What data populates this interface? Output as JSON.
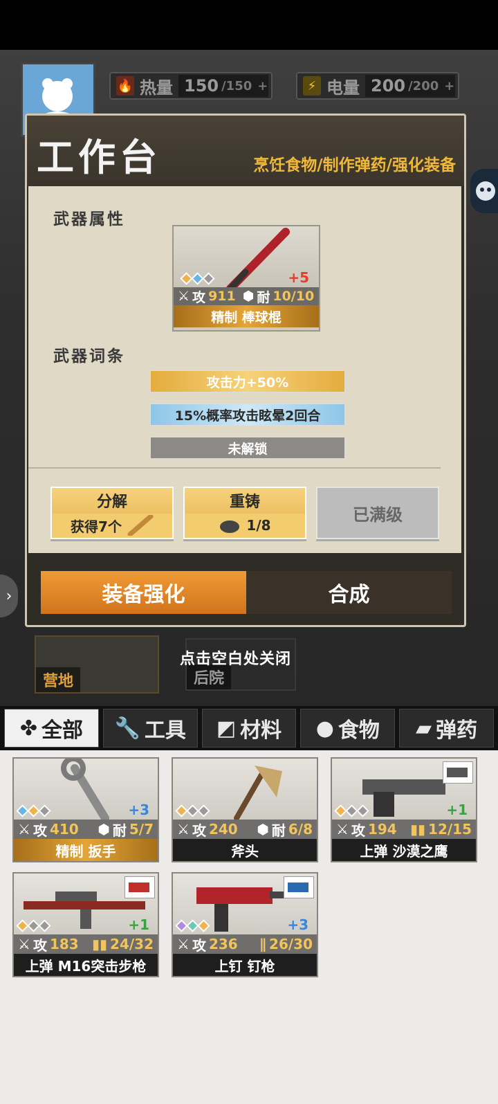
{
  "hud": {
    "heat": {
      "label": "热量",
      "value": "150",
      "max": "/150",
      "plus": "+"
    },
    "power": {
      "label": "电量",
      "value": "200",
      "max": "/200",
      "plus": "+"
    }
  },
  "bg_nav": {
    "camp": "营地",
    "backyard": "后院"
  },
  "hint": "点击空白处关闭",
  "modal": {
    "title": "工作台",
    "subtitle": "烹饪食物/制作弹药/强化装备",
    "attr_label": "武器属性",
    "affix_label": "武器词条",
    "weapon": {
      "plus": "+5",
      "atk_label": "攻",
      "atk": "911",
      "dur_label": "耐",
      "dur": "10/10",
      "name": "精制 棒球棍"
    },
    "affixes": [
      "攻击力+50%",
      "15%概率攻击眩晕2回合",
      "未解锁"
    ],
    "buttons": {
      "decompose": {
        "label": "分解",
        "sub": "获得7个"
      },
      "recast": {
        "label": "重铸",
        "sub": "1/8"
      },
      "maxed": {
        "label": "已满级"
      }
    },
    "tabs": {
      "enhance": "装备强化",
      "craft": "合成"
    }
  },
  "categories": [
    "全部",
    "工具",
    "材料",
    "食物",
    "弹药"
  ],
  "inventory": [
    {
      "name": "精制 扳手",
      "atk": "410",
      "stat2_label": "耐",
      "stat2": "5/7",
      "plus": "+3",
      "plus_color": "blue",
      "name_style": "gold"
    },
    {
      "name": "斧头",
      "atk": "240",
      "stat2_label": "耐",
      "stat2": "6/8",
      "plus": "",
      "name_style": "dark"
    },
    {
      "name": "上弹 沙漠之鹰",
      "atk": "194",
      "stat2_label": "",
      "stat2": "12/15",
      "plus": "+1",
      "plus_color": "green",
      "name_style": "dark"
    },
    {
      "name": "上弹 M16突击步枪",
      "atk": "183",
      "stat2_label": "",
      "stat2": "24/32",
      "plus": "+1",
      "plus_color": "green",
      "name_style": "dark"
    },
    {
      "name": "上钉 钉枪",
      "atk": "236",
      "stat2_label": "",
      "stat2": "26/30",
      "plus": "+3",
      "plus_color": "blue",
      "name_style": "dark"
    }
  ],
  "inv_atk_label": "攻",
  "colors": {
    "accent_gold": "#e6b04e",
    "tab_active": "#e08a2a",
    "title_orange": "#f0b83b"
  }
}
